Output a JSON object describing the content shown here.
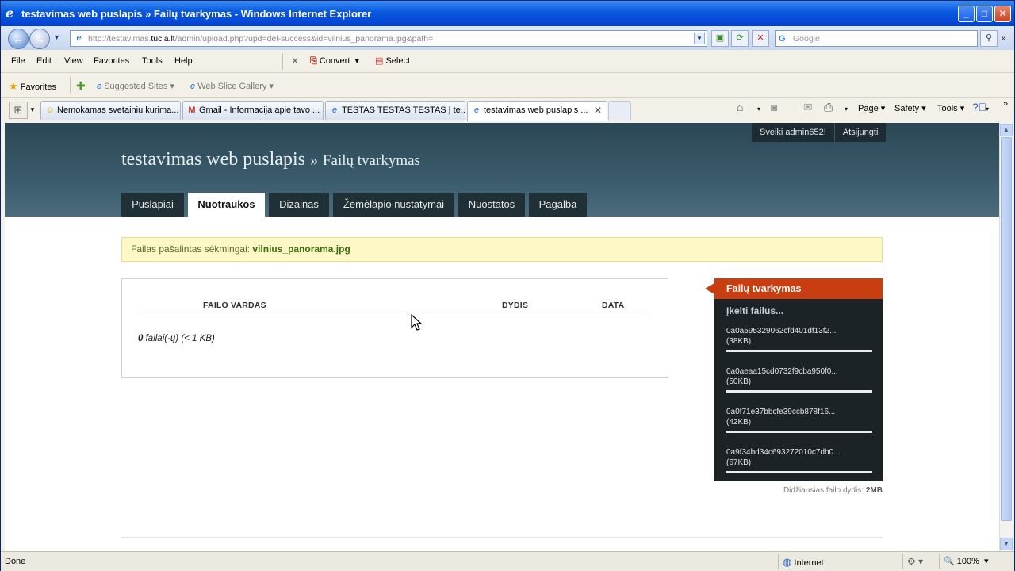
{
  "window": {
    "title": "testavimas web puslapis » Failų tvarkymas - Windows Internet Explorer",
    "min": "_",
    "max": "□",
    "close": "✕"
  },
  "address": {
    "url_prefix": "http://testavimas.",
    "url_domain": "tucia.lt",
    "url_suffix": "/admin/upload.php?upd=del-success&id=vilnius_panorama.jpg&path=",
    "search_placeholder": "Google"
  },
  "menu": [
    "File",
    "Edit",
    "View",
    "Favorites",
    "Tools",
    "Help"
  ],
  "toolbar": {
    "convert": "Convert",
    "select": "Select"
  },
  "favorites": {
    "label": "Favorites",
    "links": [
      "Suggested Sites",
      "Web Slice Gallery"
    ]
  },
  "tabs": [
    {
      "label": "Nemokamas svetainiu kurima...",
      "icon": "smiley-icon"
    },
    {
      "label": "Gmail - Informacija apie tavo ...",
      "icon": "gmail-icon"
    },
    {
      "label": "TESTAS TESTAS TESTAS | te...",
      "icon": "ie-page-icon"
    },
    {
      "label": "testavimas web puslapis ...",
      "icon": "ie-page-icon"
    }
  ],
  "commands": {
    "page": "Page",
    "safety": "Safety",
    "tools": "Tools"
  },
  "site": {
    "greeting": "Sveiki admin652!",
    "logout": "Atsijungti",
    "title": "testavimas web puslapis",
    "title_sep": "»",
    "subtitle": "Failų tvarkymas",
    "nav": [
      "Puslapiai",
      "Nuotraukos",
      "Dizainas",
      "Žemėlapio nustatymai",
      "Nuostatos",
      "Pagalba"
    ],
    "active_nav": "Nuotraukos"
  },
  "notice": {
    "text": "Failas pašalintas sėkmingai: ",
    "filename": "vilnius_panorama.jpg"
  },
  "files": {
    "columns": [
      "FAILO VARDAS",
      "DYDIS",
      "DATA"
    ],
    "count": "0",
    "summary": " failai(-ų) (< 1 KB)"
  },
  "sidebar": {
    "title": "Failų tvarkymas",
    "upload": "Įkelti failus...",
    "items": [
      {
        "name": "0a0a595329062cfd401df13f2...",
        "size": "(38KB)"
      },
      {
        "name": "0a0aeaa15cd0732f9cba950f0...",
        "size": "(50KB)"
      },
      {
        "name": "0a0f71e37bbcfe39ccb878f16...",
        "size": "(42KB)"
      },
      {
        "name": "0a9f34bd34c693272010c7db0...",
        "size": "(67KB)"
      }
    ],
    "max_size_label": "Didžiausias failo dydis: ",
    "max_size_value": "2MB"
  },
  "status": {
    "done": "Done",
    "zone": "Internet",
    "zoom": "100%"
  }
}
